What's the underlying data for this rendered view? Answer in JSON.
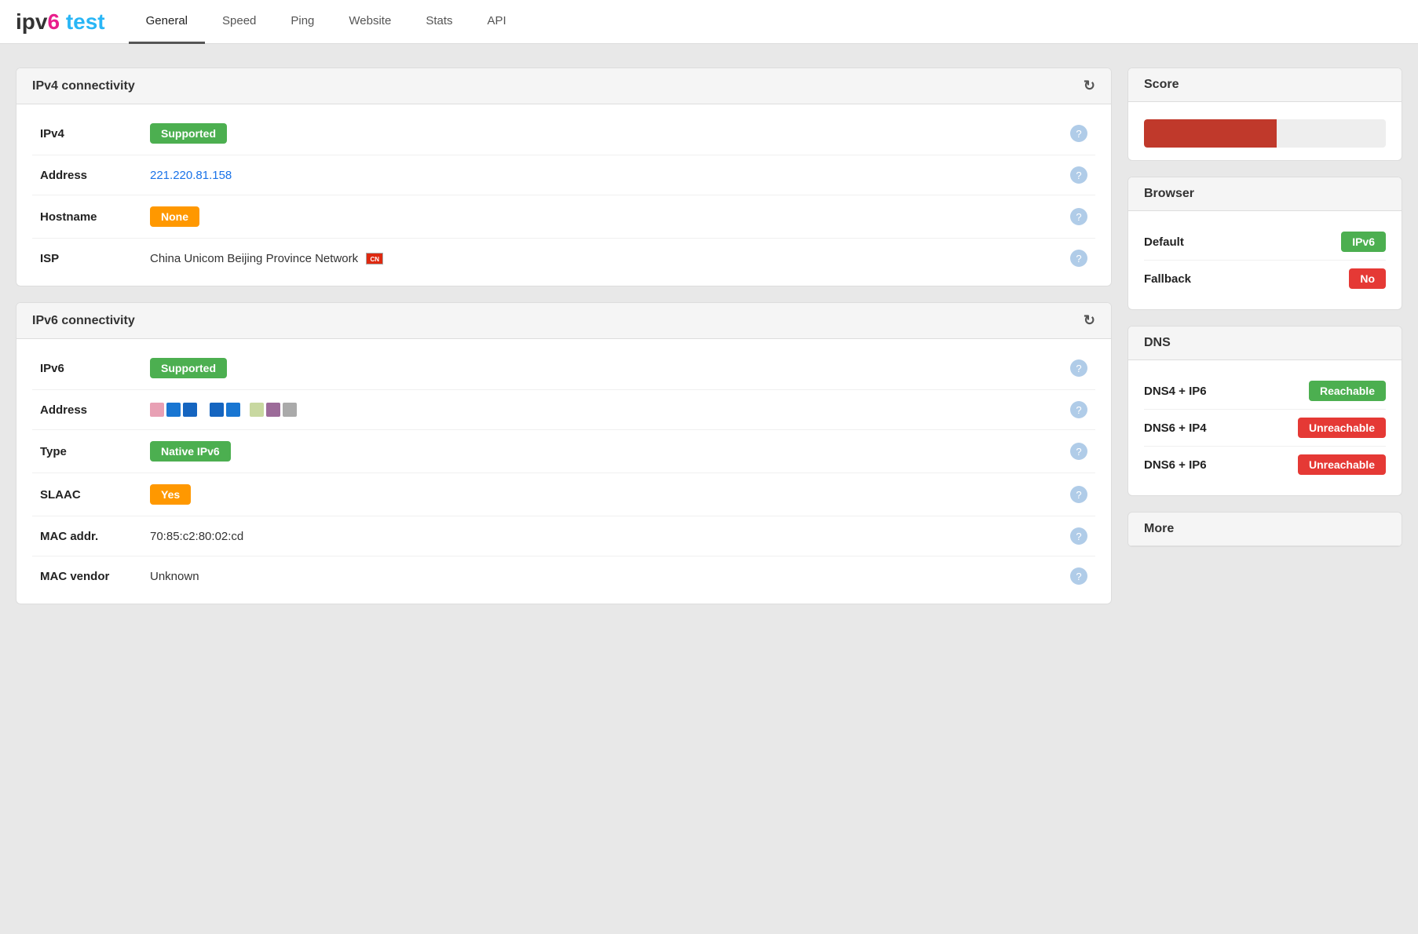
{
  "logo": {
    "ipv": "ipv",
    "six": "6",
    "test": " test"
  },
  "nav": {
    "tabs": [
      {
        "label": "General",
        "active": true
      },
      {
        "label": "Speed",
        "active": false
      },
      {
        "label": "Ping",
        "active": false
      },
      {
        "label": "Website",
        "active": false
      },
      {
        "label": "Stats",
        "active": false
      },
      {
        "label": "API",
        "active": false
      }
    ]
  },
  "ipv4": {
    "section_title": "IPv4 connectivity",
    "rows": [
      {
        "label": "IPv4",
        "type": "badge-green",
        "value": "Supported"
      },
      {
        "label": "Address",
        "type": "link",
        "value": "221.220.81.158"
      },
      {
        "label": "Hostname",
        "type": "badge-orange",
        "value": "None"
      },
      {
        "label": "ISP",
        "type": "text",
        "value": "China Unicom Beijing Province Network"
      }
    ]
  },
  "ipv6": {
    "section_title": "IPv6 connectivity",
    "rows": [
      {
        "label": "IPv6",
        "type": "badge-green",
        "value": "Supported"
      },
      {
        "label": "Address",
        "type": "ipv6addr"
      },
      {
        "label": "Type",
        "type": "badge-green-native",
        "value": "Native IPv6"
      },
      {
        "label": "SLAAC",
        "type": "badge-orange",
        "value": "Yes"
      },
      {
        "label": "MAC addr.",
        "type": "text",
        "value": "70:85:c2:80:02:cd"
      },
      {
        "label": "MAC vendor",
        "type": "text",
        "value": "Unknown"
      }
    ],
    "ipv6_blocks": [
      {
        "color": "#e8a0b4"
      },
      {
        "color": "#1976d2"
      },
      {
        "color": "#1565c0"
      },
      {
        "color": "#1565c0"
      },
      {
        "color": "#1565c0"
      },
      {
        "color": "#1976d2"
      },
      {
        "color": "#e8d8a0"
      },
      {
        "color": "#9c6b99"
      },
      {
        "color": "#aaa"
      }
    ]
  },
  "score": {
    "title": "Score",
    "bar_width_percent": 55,
    "bar_color": "#c0392b"
  },
  "browser": {
    "title": "Browser",
    "rows": [
      {
        "label": "Default",
        "badge_class": "badge-green",
        "badge_text": "IPv6"
      },
      {
        "label": "Fallback",
        "badge_class": "badge-red",
        "badge_text": "No"
      }
    ]
  },
  "dns": {
    "title": "DNS",
    "rows": [
      {
        "label": "DNS4 + IP6",
        "badge_class": "badge-green",
        "badge_text": "Reachable"
      },
      {
        "label": "DNS6 + IP4",
        "badge_class": "badge-red",
        "badge_text": "Unreachable"
      },
      {
        "label": "DNS6 + IP6",
        "badge_class": "badge-red",
        "badge_text": "Unreachable"
      }
    ]
  },
  "more": {
    "title": "More"
  }
}
